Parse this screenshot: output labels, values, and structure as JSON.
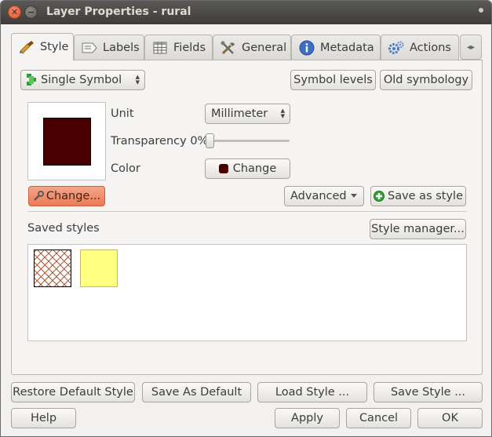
{
  "window": {
    "title": "Layer Properties - rural",
    "close_glyph": "✕",
    "minimize_glyph": "−"
  },
  "tabs": [
    {
      "label": "Style",
      "icon": "brush-icon",
      "active": true
    },
    {
      "label": "Labels",
      "icon": "label-icon",
      "active": false
    },
    {
      "label": "Fields",
      "icon": "table-icon",
      "active": false
    },
    {
      "label": "General",
      "icon": "tools-icon",
      "active": false
    },
    {
      "label": "Metadata",
      "icon": "info-icon",
      "active": false
    },
    {
      "label": "Actions",
      "icon": "gears-icon",
      "active": false
    }
  ],
  "tab_scroll_glyph": "◂▸",
  "style": {
    "renderer_select": "Single Symbol",
    "symbol_levels": "Symbol levels",
    "old_symbology": "Old symbology",
    "unit_label": "Unit",
    "unit_value": "Millimeter",
    "transparency_label": "Transparency 0%",
    "transparency_value": 0,
    "color_label": "Color",
    "color_change": "Change",
    "symbol_color": "#4a0000",
    "change_button": "Change...",
    "advanced": "Advanced",
    "save_as_style": "Save as style",
    "saved_styles_label": "Saved styles",
    "style_manager": "Style manager..."
  },
  "bottom": {
    "restore_default": "Restore Default Style",
    "save_as_default": "Save As Default",
    "load_style": "Load Style ...",
    "save_style": "Save Style ...",
    "help": "Help",
    "apply": "Apply",
    "cancel": "Cancel",
    "ok": "OK"
  },
  "colors": {
    "accent_orange": "#ec7a54",
    "titlebar": "#3d3c38",
    "saved_style_yellow": "#ffff80"
  }
}
